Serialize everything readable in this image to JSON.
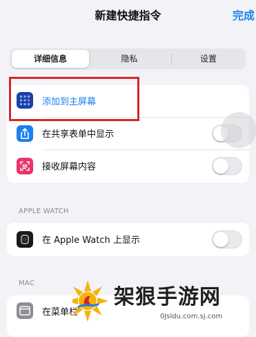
{
  "header": {
    "title": "新建快捷指令",
    "done_label": "完成"
  },
  "tabs": [
    {
      "label": "详细信息",
      "selected": true
    },
    {
      "label": "隐私",
      "selected": false
    },
    {
      "label": "设置",
      "selected": false
    }
  ],
  "section1": {
    "rows": [
      {
        "label": "添加到主屏幕",
        "icon": "home-screen-grid-icon",
        "accent": "#1a80f0"
      },
      {
        "label": "在共享表单中显示",
        "icon": "share-icon",
        "toggle": false
      },
      {
        "label": "接收屏幕内容",
        "icon": "screen-capture-icon",
        "toggle": false
      }
    ]
  },
  "section2": {
    "header": "APPLE WATCH",
    "rows": [
      {
        "label": "在 Apple Watch 上显示",
        "icon": "watch-icon",
        "toggle": false
      }
    ]
  },
  "section3": {
    "header": "MAC",
    "rows": [
      {
        "label": "在菜单栏",
        "icon": "menubar-icon"
      }
    ]
  },
  "watermark": {
    "text": "架狠手游网",
    "url": "0Jsldu.com.sj.com"
  },
  "colors": {
    "accent": "#1a80f0",
    "highlight": "#d6242a",
    "background": "#f2f2f7"
  }
}
